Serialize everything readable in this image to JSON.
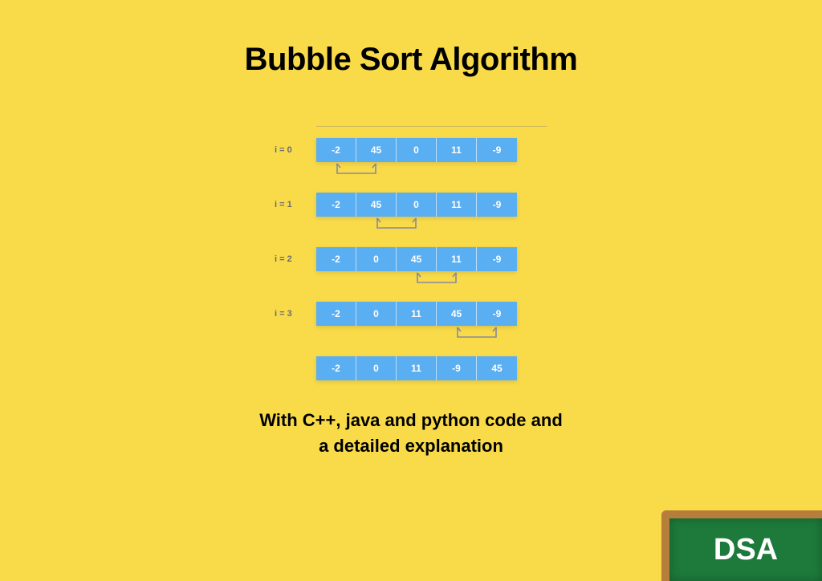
{
  "title": "Bubble Sort Algorithm",
  "subtitle_line1": "With C++, java and python  code and",
  "subtitle_line2": "a detailed explanation",
  "badge": "DSA",
  "rows": [
    {
      "label": "i = 0",
      "cells": [
        "-2",
        "45",
        "0",
        "11",
        "-9"
      ],
      "swap": [
        0,
        1
      ]
    },
    {
      "label": "i = 1",
      "cells": [
        "-2",
        "45",
        "0",
        "11",
        "-9"
      ],
      "swap": [
        1,
        2
      ]
    },
    {
      "label": "i = 2",
      "cells": [
        "-2",
        "0",
        "45",
        "11",
        "-9"
      ],
      "swap": [
        2,
        3
      ]
    },
    {
      "label": "i = 3",
      "cells": [
        "-2",
        "0",
        "11",
        "45",
        "-9"
      ],
      "swap": [
        3,
        4
      ]
    },
    {
      "label": "",
      "cells": [
        "-2",
        "0",
        "11",
        "-9",
        "45"
      ],
      "swap": null
    }
  ],
  "colors": {
    "cell_bg": "#5aaef2",
    "arrow": "#888a9c"
  }
}
